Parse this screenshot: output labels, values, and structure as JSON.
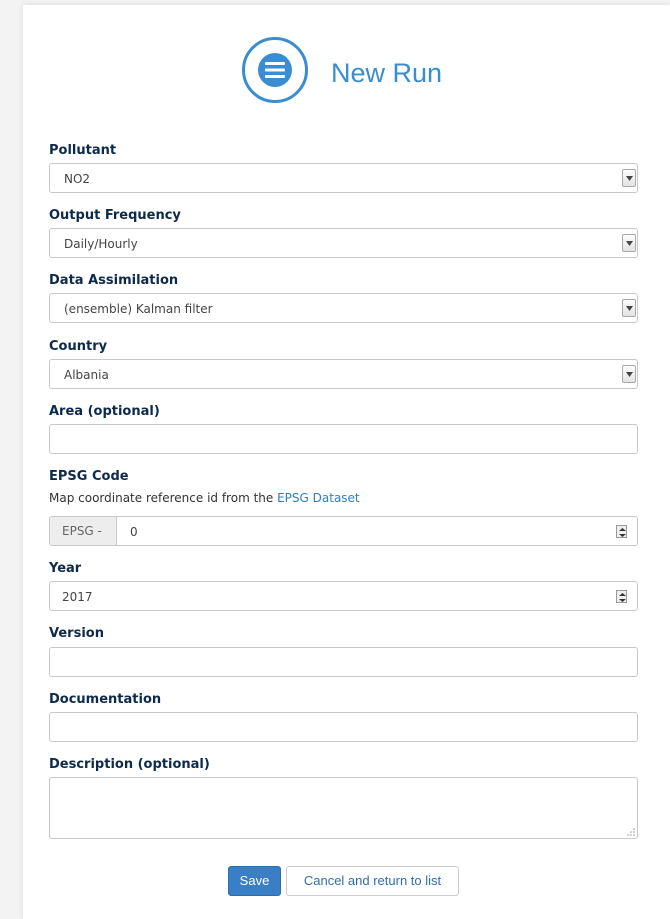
{
  "header": {
    "title": "New Run",
    "icon": "list-icon",
    "accent": "#3a8dd1"
  },
  "form": {
    "pollutant": {
      "label": "Pollutant",
      "value": "NO2"
    },
    "output_frequency": {
      "label": "Output Frequency",
      "value": "Daily/Hourly"
    },
    "data_assimilation": {
      "label": "Data Assimilation",
      "value": "(ensemble) Kalman filter"
    },
    "country": {
      "label": "Country",
      "value": "Albania"
    },
    "area": {
      "label": "Area (optional)",
      "value": ""
    },
    "epsg": {
      "label": "EPSG Code",
      "help_text": "Map coordinate reference id from the ",
      "help_link": "EPSG Dataset",
      "addon": "EPSG -",
      "value": "0"
    },
    "year": {
      "label": "Year",
      "value": "2017"
    },
    "version": {
      "label": "Version",
      "value": ""
    },
    "documentation": {
      "label": "Documentation",
      "value": ""
    },
    "description": {
      "label": "Description (optional)",
      "value": ""
    }
  },
  "actions": {
    "save_label": "Save",
    "cancel_label": "Cancel and return to list",
    "save_color": "#3a7fc6"
  }
}
